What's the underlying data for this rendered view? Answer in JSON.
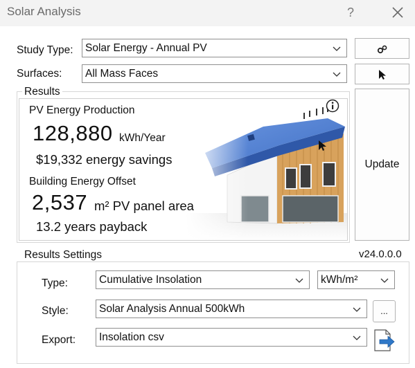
{
  "window": {
    "title": "Solar Analysis",
    "help_label": "?"
  },
  "study_type": {
    "label": "Study Type:",
    "value": "Solar Energy - Annual PV"
  },
  "surfaces": {
    "label": "Surfaces:",
    "value": "All Mass Faces"
  },
  "results": {
    "group_title": "Results",
    "pv_heading": "PV Energy Production",
    "pv_value": "128,880",
    "pv_unit": "kWh/Year",
    "savings": "$19,332 energy savings",
    "offset_heading": "Building Energy Offset",
    "area_value": "2,537",
    "area_unit": "m² PV panel area",
    "payback": "13.2 years payback",
    "info_icon": "info-icon"
  },
  "update_button": {
    "label": "Update"
  },
  "version": "v24.0.0.0",
  "settings": {
    "group_title": "Results Settings",
    "type_label": "Type:",
    "type_value": "Cumulative Insolation",
    "unit_value": "kWh/m²",
    "style_label": "Style:",
    "style_value": "Solar Analysis Annual 500kWh",
    "style_more_label": "...",
    "export_label": "Export:",
    "export_value": "Insolation csv"
  },
  "icons": {
    "settings": "gears-icon",
    "pick": "cursor-icon",
    "export": "export-arrow-icon",
    "close": "close-icon"
  },
  "colors": {
    "roof_blue": "#4f7fd1",
    "wood": "#d9a35e",
    "border": "#8f8f8f"
  }
}
